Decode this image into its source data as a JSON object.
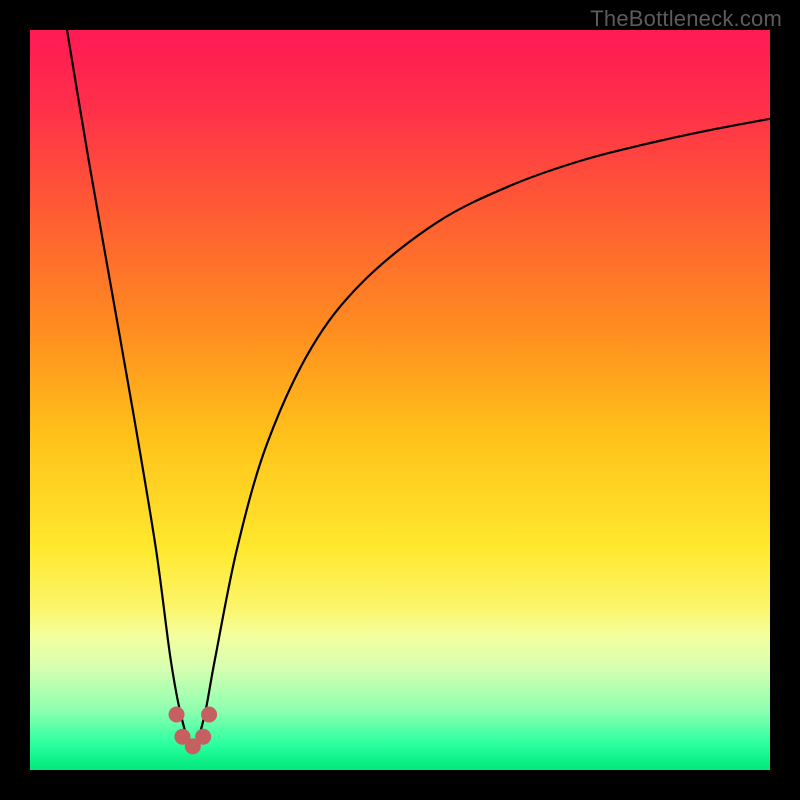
{
  "watermark": "TheBottleneck.com",
  "colors": {
    "frame": "#000000",
    "curve": "#000000",
    "marker": "#c66060",
    "gradient_stops": [
      {
        "offset": 0.0,
        "color": "#ff1a54"
      },
      {
        "offset": 0.1,
        "color": "#ff2e4a"
      },
      {
        "offset": 0.25,
        "color": "#ff5d33"
      },
      {
        "offset": 0.4,
        "color": "#ff8b20"
      },
      {
        "offset": 0.55,
        "color": "#ffc21a"
      },
      {
        "offset": 0.7,
        "color": "#ffe82e"
      },
      {
        "offset": 0.78,
        "color": "#fcf56a"
      },
      {
        "offset": 0.82,
        "color": "#f3ff9f"
      },
      {
        "offset": 0.86,
        "color": "#d8ffb0"
      },
      {
        "offset": 0.92,
        "color": "#8dffb0"
      },
      {
        "offset": 0.965,
        "color": "#2bffa0"
      },
      {
        "offset": 1.0,
        "color": "#00e87a"
      }
    ]
  },
  "chart_data": {
    "type": "line",
    "title": "",
    "xlabel": "",
    "ylabel": "",
    "xlim": [
      0,
      100
    ],
    "ylim": [
      0,
      100
    ],
    "comment": "Decorative bottleneck V-curve; axes are normalized 0-100. Minimum near x≈22 at y≈3. Left arm rises steeply to (≈5,100); right arm rises with decreasing slope to (100,≈88). A few salmon markers sit at the trough.",
    "series": [
      {
        "name": "bottleneck-curve",
        "x": [
          5,
          8,
          11,
          14,
          17,
          19,
          20.5,
          22,
          23.5,
          25,
          28,
          32,
          38,
          45,
          55,
          65,
          75,
          85,
          92,
          100
        ],
        "y": [
          100,
          82,
          65,
          48,
          30,
          15,
          7,
          3,
          7,
          15,
          30,
          44,
          57,
          66,
          74,
          79,
          82.5,
          85,
          86.5,
          88
        ]
      }
    ],
    "markers": {
      "name": "trough-markers",
      "color": "#c66060",
      "points": [
        {
          "x": 19.8,
          "y": 7.5
        },
        {
          "x": 20.6,
          "y": 4.5
        },
        {
          "x": 22.0,
          "y": 3.2
        },
        {
          "x": 23.4,
          "y": 4.5
        },
        {
          "x": 24.2,
          "y": 7.5
        }
      ]
    }
  }
}
